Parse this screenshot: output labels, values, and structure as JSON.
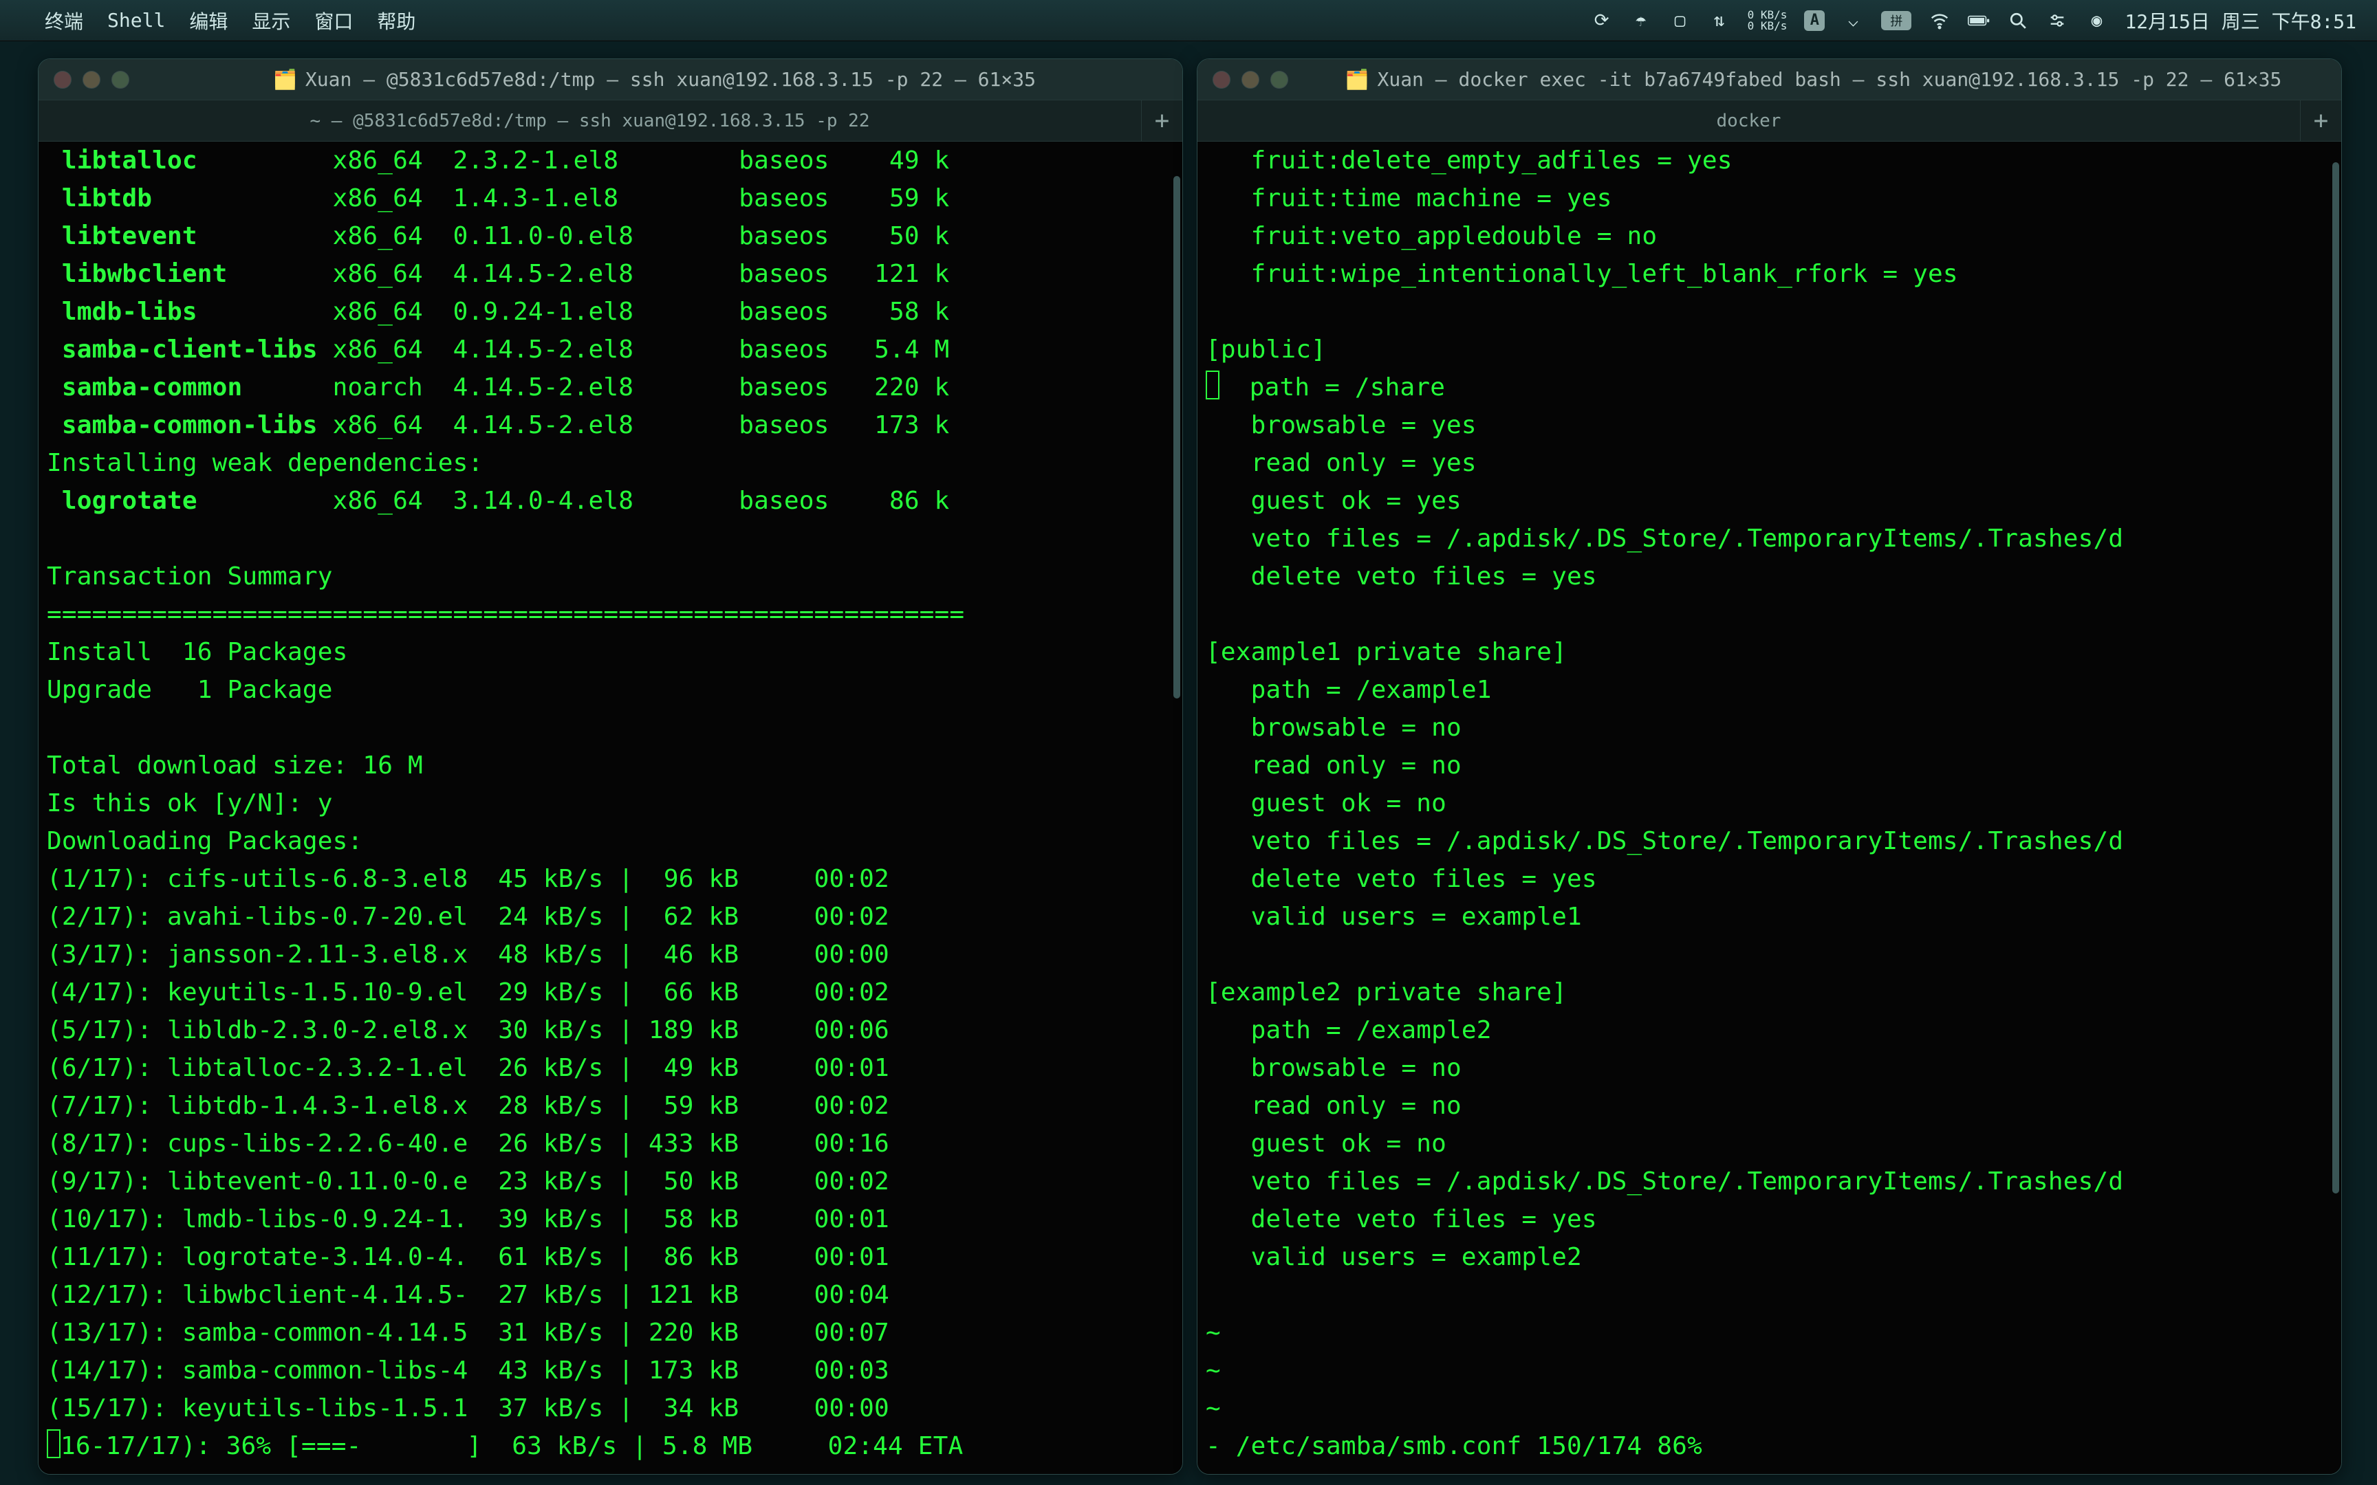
{
  "menubar": {
    "app": "终端",
    "items": [
      "Shell",
      "编辑",
      "显示",
      "窗口",
      "帮助"
    ],
    "clock": "12月15日 周三 下午8:51",
    "net_up": "0 KB/s",
    "net_down": "0 KB/s"
  },
  "left": {
    "title": "Xuan — @5831c6d57e8d:/tmp — ssh xuan@192.168.3.15 -p 22 — 61×35",
    "tab": "~ — @5831c6d57e8d:/tmp — ssh xuan@192.168.3.15 -p 22",
    "packages": [
      {
        "name": " libtalloc",
        "arch": "x86_64",
        "ver": "2.3.2-1.el8",
        "repo": "baseos",
        "size": "49 k"
      },
      {
        "name": " libtdb",
        "arch": "x86_64",
        "ver": "1.4.3-1.el8",
        "repo": "baseos",
        "size": "59 k"
      },
      {
        "name": " libtevent",
        "arch": "x86_64",
        "ver": "0.11.0-0.el8",
        "repo": "baseos",
        "size": "50 k"
      },
      {
        "name": " libwbclient",
        "arch": "x86_64",
        "ver": "4.14.5-2.el8",
        "repo": "baseos",
        "size": "121 k"
      },
      {
        "name": " lmdb-libs",
        "arch": "x86_64",
        "ver": "0.9.24-1.el8",
        "repo": "baseos",
        "size": "58 k"
      },
      {
        "name": " samba-client-libs",
        "arch": "x86_64",
        "ver": "4.14.5-2.el8",
        "repo": "baseos",
        "size": "5.4 M"
      },
      {
        "name": " samba-common",
        "arch": "noarch",
        "ver": "4.14.5-2.el8",
        "repo": "baseos",
        "size": "220 k"
      },
      {
        "name": " samba-common-libs",
        "arch": "x86_64",
        "ver": "4.14.5-2.el8",
        "repo": "baseos",
        "size": "173 k"
      }
    ],
    "weakdep_label": "Installing weak dependencies:",
    "weakdep": {
      "name": " logrotate",
      "arch": "x86_64",
      "ver": "3.14.0-4.el8",
      "repo": "baseos",
      "size": "86 k"
    },
    "txn_summary": "Transaction Summary",
    "divider": "=============================================================",
    "install_line": "Install  16 Packages",
    "upgrade_line": "Upgrade   1 Package",
    "total_size": "Total download size: 16 M",
    "confirm": "Is this ok [y/N]: y",
    "downloading": "Downloading Packages:",
    "downloads": [
      "(1/17): cifs-utils-6.8-3.el8  45 kB/s |  96 kB     00:02",
      "(2/17): avahi-libs-0.7-20.el  24 kB/s |  62 kB     00:02",
      "(3/17): jansson-2.11-3.el8.x  48 kB/s |  46 kB     00:00",
      "(4/17): keyutils-1.5.10-9.el  29 kB/s |  66 kB     00:02",
      "(5/17): libldb-2.3.0-2.el8.x  30 kB/s | 189 kB     00:06",
      "(6/17): libtalloc-2.3.2-1.el  26 kB/s |  49 kB     00:01",
      "(7/17): libtdb-1.4.3-1.el8.x  28 kB/s |  59 kB     00:02",
      "(8/17): cups-libs-2.2.6-40.e  26 kB/s | 433 kB     00:16",
      "(9/17): libtevent-0.11.0-0.e  23 kB/s |  50 kB     00:02",
      "(10/17): lmdb-libs-0.9.24-1.  39 kB/s |  58 kB     00:01",
      "(11/17): logrotate-3.14.0-4.  61 kB/s |  86 kB     00:01",
      "(12/17): libwbclient-4.14.5-  27 kB/s | 121 kB     00:04",
      "(13/17): samba-common-4.14.5  31 kB/s | 220 kB     00:07",
      "(14/17): samba-common-libs-4  43 kB/s | 173 kB     00:03",
      "(15/17): keyutils-libs-1.5.1  37 kB/s |  34 kB     00:00"
    ],
    "progress": "(16-17/17): 36% [===-       ]  63 kB/s | 5.8 MB     02:44 ETA"
  },
  "right": {
    "title": "Xuan — docker exec -it b7a6749fabed bash — ssh xuan@192.168.3.15 -p 22 — 61×35",
    "tab": "docker",
    "lines": [
      "   fruit:delete_empty_adfiles = yes",
      "   fruit:time machine = yes",
      "   fruit:veto_appledouble = no",
      "   fruit:wipe_intentionally_left_blank_rfork = yes",
      "",
      "[public]",
      "   path = /share",
      "   browsable = yes",
      "   read only = yes",
      "   guest ok = yes",
      "   veto files = /.apdisk/.DS_Store/.TemporaryItems/.Trashes/d",
      "   delete veto files = yes",
      "",
      "[example1 private share]",
      "   path = /example1",
      "   browsable = no",
      "   read only = no",
      "   guest ok = no",
      "   veto files = /.apdisk/.DS_Store/.TemporaryItems/.Trashes/d",
      "   delete veto files = yes",
      "   valid users = example1",
      "",
      "[example2 private share]",
      "   path = /example2",
      "   browsable = no",
      "   read only = no",
      "   guest ok = no",
      "   veto files = /.apdisk/.DS_Store/.TemporaryItems/.Trashes/d",
      "   delete veto files = yes",
      "   valid users = example2",
      "",
      "~",
      "~",
      "~"
    ],
    "status": "- /etc/samba/smb.conf 150/174 86%"
  }
}
